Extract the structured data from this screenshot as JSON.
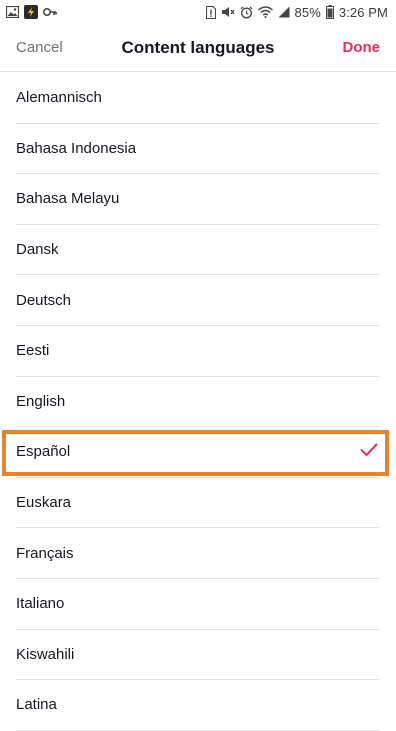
{
  "status_bar": {
    "battery": "85%",
    "time": "3:26 PM"
  },
  "header": {
    "cancel_label": "Cancel",
    "title": "Content languages",
    "done_label": "Done"
  },
  "languages": [
    {
      "label": "Alemannisch",
      "selected": false
    },
    {
      "label": "Bahasa Indonesia",
      "selected": false
    },
    {
      "label": "Bahasa Melayu",
      "selected": false
    },
    {
      "label": "Dansk",
      "selected": false
    },
    {
      "label": "Deutsch",
      "selected": false
    },
    {
      "label": "Eesti",
      "selected": false
    },
    {
      "label": "English",
      "selected": false
    },
    {
      "label": "Español",
      "selected": true
    },
    {
      "label": "Euskara",
      "selected": false
    },
    {
      "label": "Français",
      "selected": false
    },
    {
      "label": "Italiano",
      "selected": false
    },
    {
      "label": "Kiswahili",
      "selected": false
    },
    {
      "label": "Latina",
      "selected": false
    }
  ],
  "colors": {
    "accent": "#e0335a",
    "highlight": "#e8822b"
  }
}
